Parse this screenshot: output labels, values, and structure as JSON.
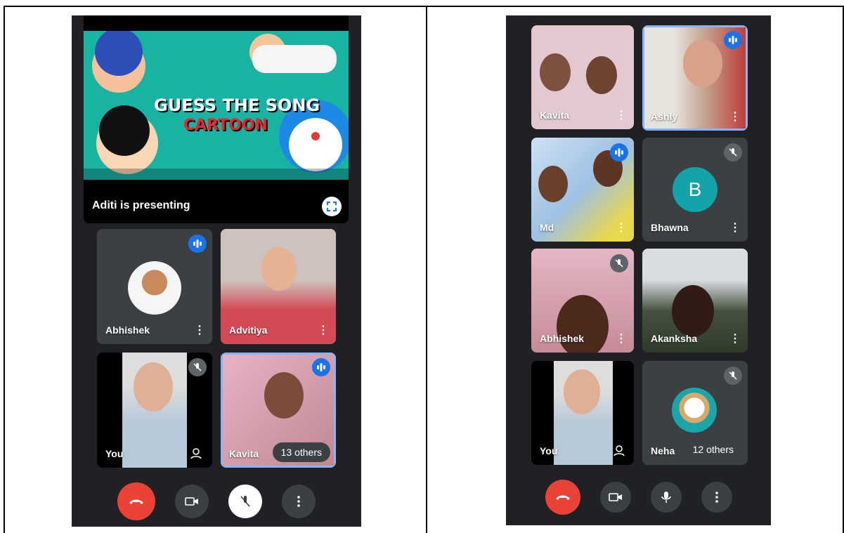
{
  "left": {
    "presentation": {
      "label": "Aditi is presenting",
      "title_line1": "GUESS THE SONG",
      "title_line2": "CARTOON"
    },
    "tiles": [
      {
        "name": "Abhishek",
        "status": "speaking"
      },
      {
        "name": "Advitiya",
        "status": "none"
      },
      {
        "name": "You",
        "status": "muted"
      },
      {
        "name": "Kavita",
        "status": "speaking",
        "others": "13 others"
      }
    ]
  },
  "right": {
    "tiles": [
      {
        "name": "Kavita",
        "status": "none"
      },
      {
        "name": "Ashly",
        "status": "speaking"
      },
      {
        "name": "Md",
        "status": "speaking"
      },
      {
        "name": "Bhawna",
        "status": "muted",
        "avatar_letter": "B"
      },
      {
        "name": "Abhishek",
        "status": "muted"
      },
      {
        "name": "Akanksha",
        "status": "none"
      },
      {
        "name": "You",
        "status": "none"
      },
      {
        "name": "Neha",
        "status": "muted",
        "others": "12 others"
      }
    ]
  },
  "icons": {
    "speaking": "audio-wave-icon",
    "muted": "mic-off-icon",
    "end_call": "end-call-icon",
    "camera": "video-camera-icon",
    "mic": "mic-icon",
    "more": "more-vert-icon",
    "fullscreen": "fullscreen-icon"
  },
  "colors": {
    "background": "#202124",
    "tile": "#3c4043",
    "accent_blue": "#1a73e8",
    "end_call": "#ea4335",
    "avatar_teal": "#12a4a8"
  },
  "more_glyph": "⋮"
}
